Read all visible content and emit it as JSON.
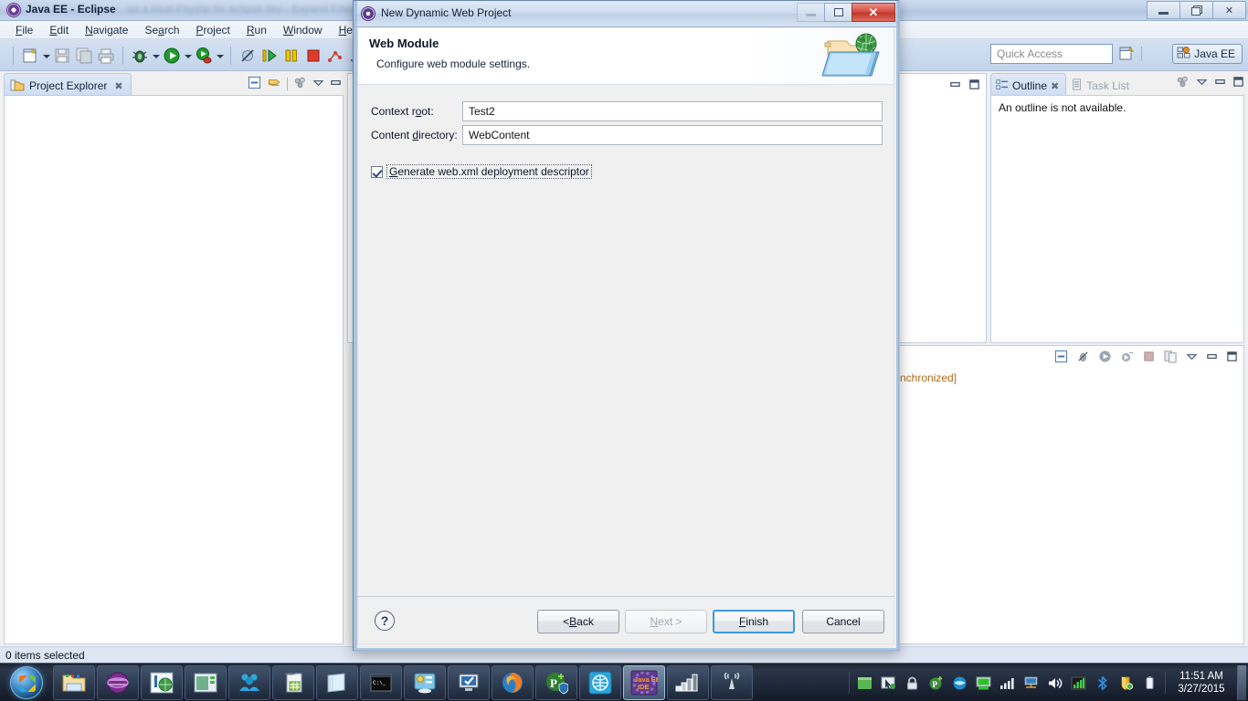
{
  "eclipse": {
    "title": "Java EE - Eclipse",
    "title_ghost": "so a local Payslip for eclipse dev - Expand Files Win dev",
    "menu": [
      {
        "label": "File",
        "mnemonic": "F"
      },
      {
        "label": "Edit",
        "mnemonic": "E"
      },
      {
        "label": "Navigate",
        "mnemonic": "N"
      },
      {
        "label": "Search",
        "mnemonic": "a"
      },
      {
        "label": "Project",
        "mnemonic": "P"
      },
      {
        "label": "Run",
        "mnemonic": "R"
      },
      {
        "label": "Window",
        "mnemonic": "W"
      },
      {
        "label": "Help",
        "mnemonic": "H"
      }
    ],
    "toolbar_icons": [
      "new-wizard-icon",
      "new-wizard-dropdown-icon",
      "save-icon",
      "save-all-icon",
      "print-icon",
      "debug-icon",
      "debug-dropdown-icon",
      "run-icon",
      "run-dropdown-icon",
      "run-external-tools-icon",
      "run-external-tools-dropdown-icon",
      "skip-all-breakpoints-icon",
      "step-into-icon",
      "suspend-icon",
      "terminate-icon",
      "next-annotation-icon",
      "previous-annotation-icon"
    ],
    "quick_access": {
      "placeholder": "Quick Access",
      "value": ""
    },
    "perspective": {
      "new_perspective_icon": "open-perspective-icon",
      "current": "Java EE"
    },
    "window_buttons": {
      "minimize": "minimize-icon",
      "restore": "restore-icon",
      "close": "close-icon"
    },
    "status_bar": {
      "text": "0 items selected"
    }
  },
  "project_explorer": {
    "tab_label": "Project Explorer",
    "close_glyph": "✖",
    "tools": [
      "collapse-all-icon",
      "link-with-editor-icon",
      "view-menu-icon",
      "minimize-icon",
      "maximize-icon"
    ]
  },
  "outline": {
    "tabs": [
      {
        "label": "Outline",
        "active": true,
        "icon": "outline-icon",
        "close_glyph": "✖"
      },
      {
        "label": "Task List",
        "active": false,
        "icon": "tasklist-icon"
      }
    ],
    "empty_message": "An outline is not available."
  },
  "bottom_view": {
    "text": "nchronized]",
    "tools": [
      "clear-console-icon",
      "skip-breakpoints-icon",
      "run-icon",
      "profile-icon",
      "terminate-icon",
      "copy-icon",
      "view-menu-icon",
      "minimize-icon",
      "maximize-icon"
    ]
  },
  "dialog": {
    "title": "New Dynamic Web Project",
    "icon": "eclipse-wizard-icon",
    "window_buttons": {
      "minimize": "minimize-icon",
      "maximize": "maximize-icon",
      "close": "✕"
    },
    "header": {
      "title": "Web Module",
      "subtitle": "Configure web module settings.",
      "icon": "web-folder-globe-icon"
    },
    "fields": [
      {
        "label": "Context root:",
        "label_pre": "Context r",
        "label_mnemonic": "o",
        "label_post": "ot:",
        "value": "Test2",
        "name": "context-root-input"
      },
      {
        "label": "Content directory:",
        "label_pre": "Content ",
        "label_mnemonic": "d",
        "label_post": "irectory:",
        "value": "WebContent",
        "name": "content-directory-input"
      }
    ],
    "checkbox": {
      "label": "Generate web.xml deployment descriptor",
      "label_pre": "",
      "label_mnemonic": "G",
      "label_post": "enerate web.xml deployment descriptor",
      "checked": true,
      "focused": true
    },
    "footer": {
      "help_glyph": "?",
      "buttons": [
        {
          "label": "< Back",
          "pre": "< ",
          "mnemonic": "B",
          "post": "ack",
          "state": "enabled",
          "name": "back-button"
        },
        {
          "label": "Next >",
          "pre": "",
          "mnemonic": "N",
          "post": "ext >",
          "state": "disabled",
          "name": "next-button"
        },
        {
          "label": "Finish",
          "pre": "",
          "mnemonic": "F",
          "post": "inish",
          "state": "default",
          "name": "finish-button"
        },
        {
          "label": "Cancel",
          "pre": "Cancel",
          "mnemonic": "",
          "post": "",
          "state": "enabled",
          "name": "cancel-button"
        }
      ]
    }
  },
  "taskbar": {
    "start_label": "start-orb",
    "items": [
      {
        "name": "windows-explorer",
        "icon": "folder-icon"
      },
      {
        "name": "media-player",
        "icon": "purple-orb-icon"
      },
      {
        "name": "paint-tool",
        "icon": "paint-globe-icon"
      },
      {
        "name": "presentation-app",
        "icon": "window-icon"
      },
      {
        "name": "team-viewer",
        "icon": "people-icon"
      },
      {
        "name": "spreadsheet-app",
        "icon": "spreadsheet-icon"
      },
      {
        "name": "notepad-app",
        "icon": "notepad-icon"
      },
      {
        "name": "command-prompt",
        "icon": "console-icon"
      },
      {
        "name": "control-panel",
        "icon": "settings-icon"
      },
      {
        "name": "system-monitor",
        "icon": "monitor-check-icon"
      },
      {
        "name": "firefox-browser",
        "icon": "firefox-icon"
      },
      {
        "name": "pdf-tool",
        "icon": "p-plus-icon"
      },
      {
        "name": "globe-app",
        "icon": "globe-icon"
      },
      {
        "name": "eclipse-java-ee",
        "icon": "java-ee-ide-icon",
        "label": "Java EE IDE",
        "active": true
      },
      {
        "name": "network-graph",
        "icon": "bars-icon"
      },
      {
        "name": "wireless-tool",
        "icon": "antenna-icon"
      }
    ],
    "tray": [
      {
        "name": "tray-show-hidden",
        "icon": "green-window-icon"
      },
      {
        "name": "tray-cursor",
        "icon": "cursor-icon"
      },
      {
        "name": "tray-security",
        "icon": "lock-icon"
      },
      {
        "name": "tray-pdf",
        "icon": "p-plus-icon"
      },
      {
        "name": "tray-update",
        "icon": "blue-circle-icon"
      },
      {
        "name": "tray-presentation",
        "icon": "green-screen-icon"
      },
      {
        "name": "tray-signal",
        "icon": "signal-bars-icon"
      },
      {
        "name": "tray-network",
        "icon": "network-icon"
      },
      {
        "name": "tray-volume",
        "icon": "speaker-icon"
      },
      {
        "name": "tray-graph",
        "icon": "graph-icon"
      },
      {
        "name": "tray-bluetooth",
        "icon": "bluetooth-icon"
      },
      {
        "name": "tray-antivirus",
        "icon": "shield-icon"
      },
      {
        "name": "tray-battery",
        "icon": "battery-icon"
      }
    ],
    "clock": {
      "time": "11:51 AM",
      "date": "3/27/2015"
    }
  }
}
